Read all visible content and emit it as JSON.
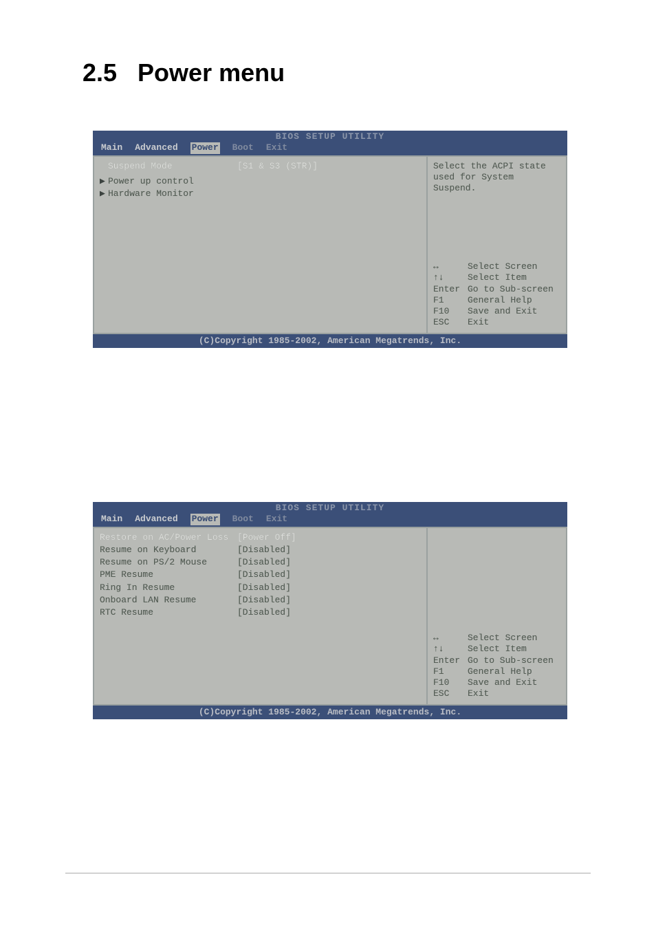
{
  "page": {
    "section_number": "2.5",
    "section_title": "Power menu"
  },
  "bios_common": {
    "header_title": "BIOS SETUP UTILITY",
    "tabs": {
      "main": "Main",
      "advanced": "Advanced",
      "power": "Power",
      "boot": "Boot",
      "exit": "Exit"
    },
    "footer": "(C)Copyright 1985-2002, American Megatrends, Inc.",
    "legend": {
      "select_screen": "Select Screen",
      "select_item": "Select Item",
      "enter_key": "Enter",
      "enter_txt": "Go to Sub-screen",
      "f1_key": "F1",
      "f1_txt": "General Help",
      "f10_key": "F10",
      "f10_txt": "Save and Exit",
      "esc_key": "ESC",
      "esc_txt": "Exit",
      "arrows_lr": "↔",
      "arrows_ud": "↑↓"
    }
  },
  "screen1": {
    "help": "Select the ACPI state used for System Suspend.",
    "items": [
      {
        "label": "Suspend Mode",
        "value": "[S1 & S3 (STR)]",
        "highlight": true,
        "arrow": false
      },
      {
        "label": "Power up control",
        "value": "",
        "highlight": false,
        "arrow": true
      },
      {
        "label": "Hardware Monitor",
        "value": "",
        "highlight": false,
        "arrow": true
      }
    ]
  },
  "screen2": {
    "help": "",
    "items": [
      {
        "label": "Restore on AC/Power Loss",
        "value": "[Power Off]",
        "highlight": true
      },
      {
        "label": "Resume on Keyboard",
        "value": "[Disabled]"
      },
      {
        "label": "Resume on PS/2 Mouse",
        "value": "[Disabled]"
      },
      {
        "label": "PME Resume",
        "value": "[Disabled]"
      },
      {
        "label": "Ring In Resume",
        "value": "[Disabled]"
      },
      {
        "label": "Onboard LAN Resume",
        "value": "[Disabled]"
      },
      {
        "label": "RTC Resume",
        "value": "[Disabled]"
      }
    ]
  }
}
